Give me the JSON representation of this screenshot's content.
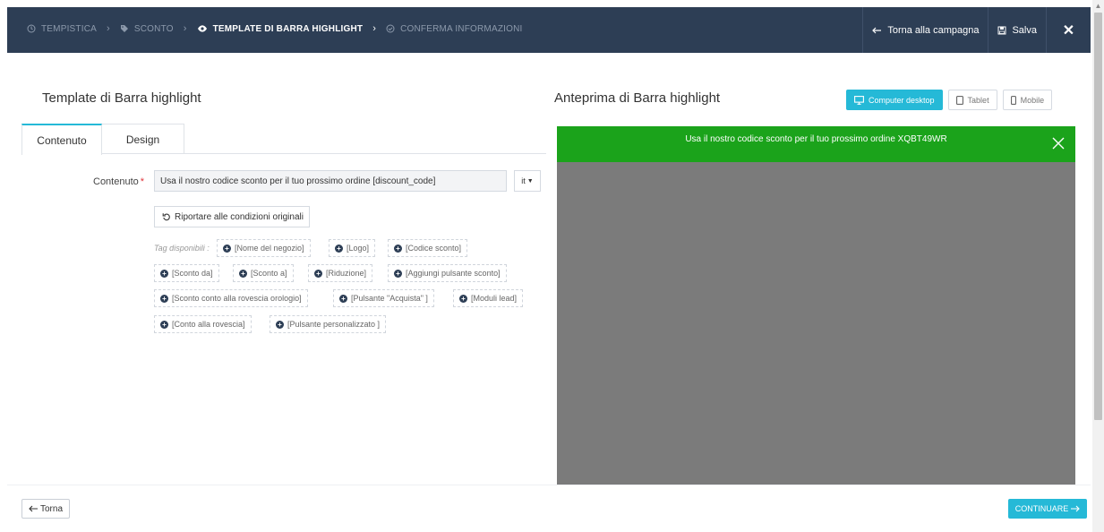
{
  "header": {
    "steps": [
      {
        "label": "TEMPISTICA",
        "icon": "clock-icon"
      },
      {
        "label": "SCONTO",
        "icon": "tag-icon"
      },
      {
        "label": "TEMPLATE DI BARRA HIGHLIGHT",
        "icon": "eye-icon"
      },
      {
        "label": "CONFERMA INFORMAZIONI",
        "icon": "check-circle-icon"
      }
    ],
    "back_to_campaign": "Torna alla campagna",
    "save": "Salva",
    "close": "✕"
  },
  "left": {
    "title": "Template di Barra highlight",
    "tabs": [
      {
        "label": "Contenuto",
        "active": true
      },
      {
        "label": "Design",
        "active": false
      }
    ],
    "content_label": "Contenuto",
    "required_mark": "*",
    "content_value": "Usa il nostro codice sconto per il tuo prossimo ordine [discount_code]",
    "lang": "it",
    "reset_label": "Riportare alle condizioni originali",
    "tags_label": "Tag disponibili :",
    "tags": [
      "[Nome del negozio]",
      "[Logo]",
      "[Codice sconto]",
      "[Sconto da]",
      "[Sconto a]",
      "[Riduzione]",
      "[Aggiungi pulsante sconto]",
      "[Sconto conto alla rovescia orologio]",
      "[Pulsante \"Acquista\" ]",
      "[Moduli lead]",
      "[Conto alla rovescia]",
      "[Pulsante personalizzato ]"
    ]
  },
  "right": {
    "title": "Anteprima di Barra highlight",
    "devices": [
      {
        "label": "Computer desktop",
        "active": true
      },
      {
        "label": "Tablet",
        "active": false
      },
      {
        "label": "Mobile",
        "active": false
      }
    ],
    "preview_text": "Usa il nostro codice sconto per il tuo prossimo ordine XQBT49WR",
    "preview_bar_color": "#1ba31b",
    "preview_bg_color": "#7b7b7b"
  },
  "footer": {
    "back_label": "Torna",
    "continue_label": "CONTINUARE"
  },
  "colors": {
    "header_bg": "#2d3e55",
    "accent": "#25b9d7"
  }
}
